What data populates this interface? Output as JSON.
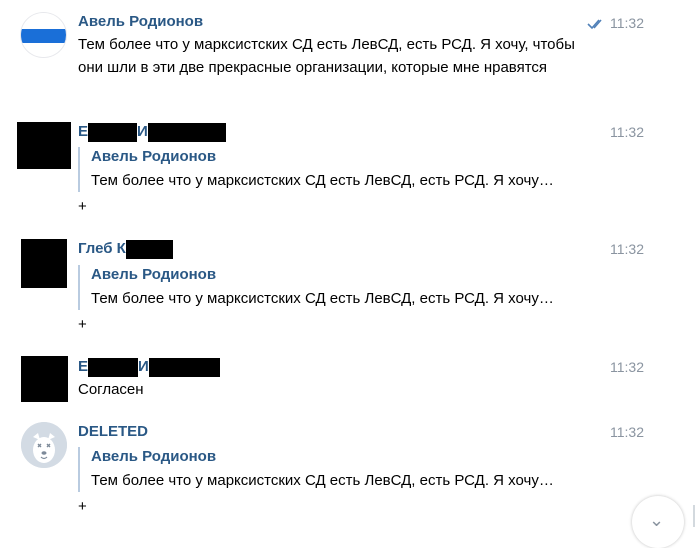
{
  "messages": [
    {
      "author": "Авель Родионов",
      "time": "11:32",
      "read_status": "double-check-icon",
      "text": "Тем более что у марксистских СД есть ЛевСД, есть РСД. Я хочу, чтобы они шли в эти две прекрасные организации, которые мне нравятся"
    },
    {
      "author_first": "Е",
      "author_second": "И",
      "time": "11:32",
      "quote_author": "Авель Родионов",
      "quote_text": "Тем более что у марксистских СД есть ЛевСД, есть РСД. Я хочу…",
      "text": "+"
    },
    {
      "author_first": "Глеб К",
      "time": "11:32",
      "quote_author": "Авель Родионов",
      "quote_text": "Тем более что у марксистских СД есть ЛевСД, есть РСД. Я хочу…",
      "text": "+"
    },
    {
      "author_first": "Е",
      "author_second": "И",
      "time": "11:32",
      "text": "Согласен"
    },
    {
      "author": "DELETED",
      "time": "11:32",
      "quote_author": "Авель Родионов",
      "quote_text": "Тем более что у марксистских СД есть ЛевСД, есть РСД. Я хочу…",
      "text": "+"
    }
  ],
  "colors": {
    "author": "#2a5885",
    "time": "#8a94a0",
    "quote_border": "#b9cbe0",
    "read_check": "#5181b8"
  },
  "scroll_down": {
    "icon": "chevron-down-icon",
    "glyph": "⌄"
  }
}
